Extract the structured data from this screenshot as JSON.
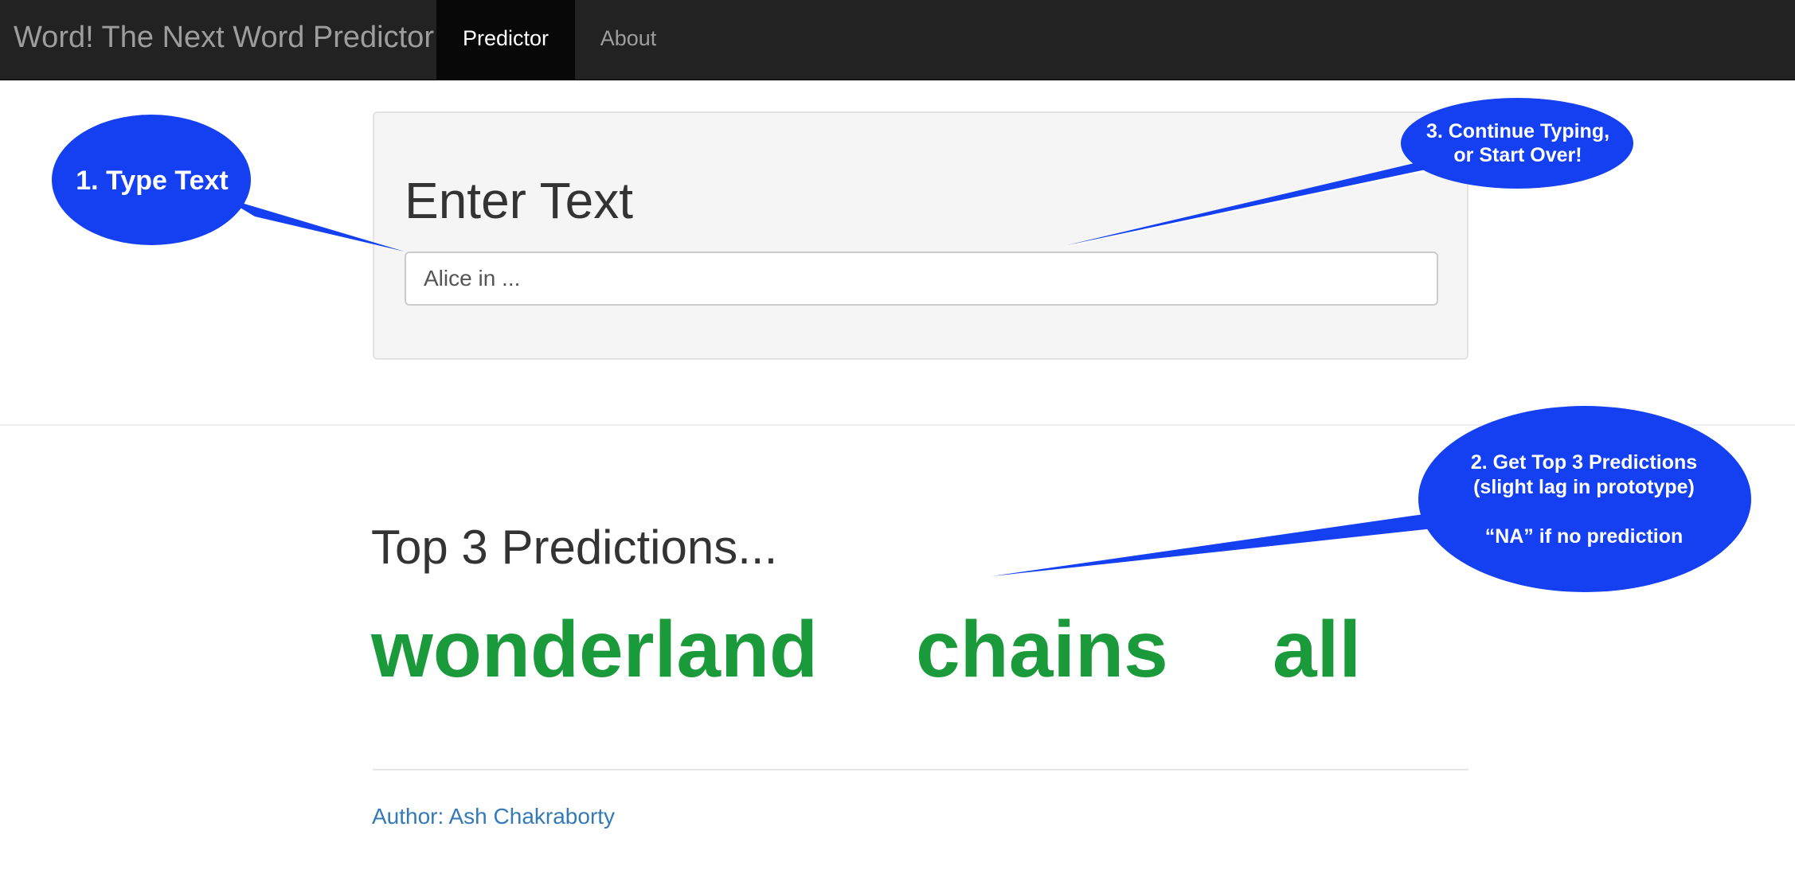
{
  "navbar": {
    "brand": "Word! The Next Word Predictor",
    "tabs": [
      {
        "label": "Predictor",
        "active": true
      },
      {
        "label": "About",
        "active": false
      }
    ]
  },
  "input_panel": {
    "title": "Enter Text",
    "input_value": "Alice in ..."
  },
  "predictions": {
    "title": "Top 3 Predictions...",
    "words": [
      "wonderland",
      "chains",
      "all"
    ],
    "color": "#1a9a3a"
  },
  "footer": {
    "author": "Author: Ash Chakraborty"
  },
  "callouts": {
    "color": "#1540f2",
    "type_text": "1. Type Text",
    "continue": "3. Continue Typing,\nor Start Over!",
    "predictions": "2. Get Top 3 Predictions\n(slight lag in prototype)\n\n“NA” if no prediction"
  }
}
